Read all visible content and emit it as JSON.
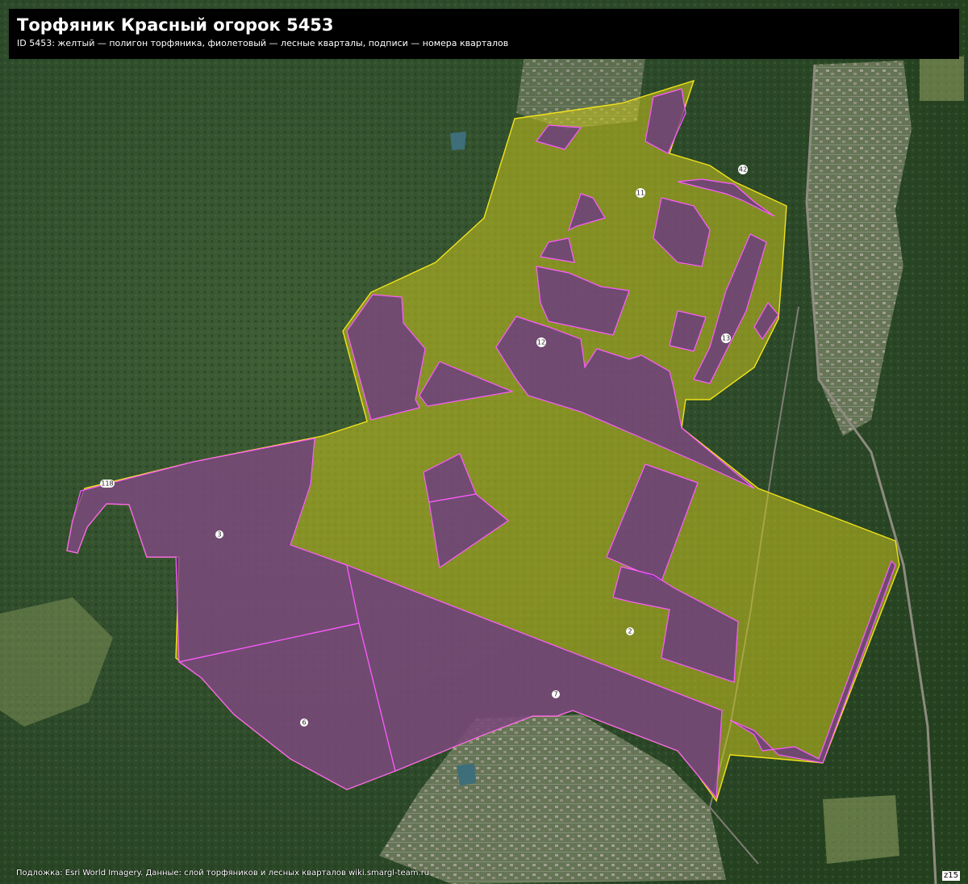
{
  "title": "Торфяник Красный огорок 5453",
  "subtitle": "ID 5453: желтый — полигон торфяника, фиолетовый — лесные кварталы, подписи — номера кварталов",
  "attribution": "Подложка: Esri World Imagery. Данные: слой торфяников и лесных кварталов wiki.smargl-team.ru",
  "zoom": "z15",
  "colors": {
    "peat_fill": "#c8c41e",
    "peat_stroke": "#f2e21a",
    "forest_fill": "#6a2f8f",
    "forest_stroke": "#ff5cff",
    "label_bg": "#ffffff"
  },
  "quarters": [
    {
      "id": "q3",
      "label": "3"
    },
    {
      "id": "q6",
      "label": "6"
    },
    {
      "id": "q7",
      "label": "7"
    },
    {
      "id": "q2",
      "label": "2"
    },
    {
      "id": "q11",
      "label": "11"
    },
    {
      "id": "q12",
      "label": "12"
    },
    {
      "id": "q13",
      "label": "13"
    },
    {
      "id": "q42",
      "label": "42"
    },
    {
      "id": "q118",
      "label": "118"
    }
  ]
}
